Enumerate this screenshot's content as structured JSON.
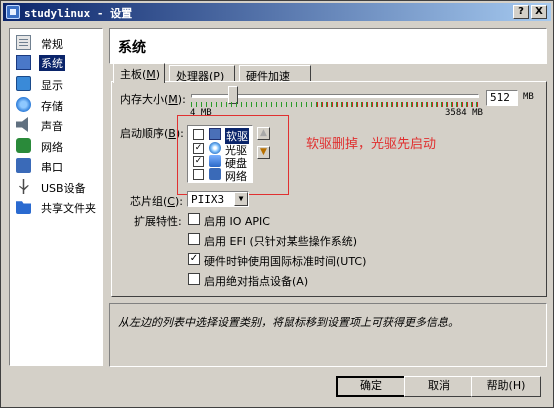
{
  "window": {
    "title": "studylinux - 设置",
    "help_glyph": "?",
    "close_glyph": "X"
  },
  "sidebar": {
    "items": [
      {
        "label": "常规",
        "icon": "general-icon"
      },
      {
        "label": "系统",
        "icon": "system-icon",
        "selected": true
      },
      {
        "label": "显示",
        "icon": "display-icon"
      },
      {
        "label": "存储",
        "icon": "storage-icon"
      },
      {
        "label": "声音",
        "icon": "audio-icon"
      },
      {
        "label": "网络",
        "icon": "network-icon"
      },
      {
        "label": "串口",
        "icon": "serial-port-icon"
      },
      {
        "label": "USB设备",
        "icon": "usb-icon"
      },
      {
        "label": "共享文件夹",
        "icon": "shared-folder-icon"
      }
    ]
  },
  "page": {
    "title": "系统"
  },
  "tabs": [
    {
      "label": "主板",
      "key": "M",
      "active": true
    },
    {
      "label": "处理器",
      "key": "P"
    },
    {
      "label": "硬件加速",
      "key": ""
    }
  ],
  "motherboard": {
    "memory": {
      "label": "内存大小",
      "key": "M",
      "value": "512",
      "unit": "MB",
      "min_label": "4 MB",
      "max_label": "3584 MB"
    },
    "boot_order": {
      "label": "启动顺序",
      "key": "B",
      "items": [
        {
          "label": "软驱",
          "checked": false,
          "icon": "floppy-icon",
          "selected": true
        },
        {
          "label": "光驱",
          "checked": true,
          "icon": "cd-icon"
        },
        {
          "label": "硬盘",
          "checked": true,
          "icon": "hdd-icon"
        },
        {
          "label": "网络",
          "checked": false,
          "icon": "network-boot-icon"
        }
      ],
      "up_glyph": "▲",
      "down_glyph": "▼"
    },
    "chipset": {
      "label": "芯片组",
      "key": "C",
      "value": "PIIX3"
    },
    "features": {
      "label": "扩展特性",
      "items": [
        {
          "label": "启用 IO APIC",
          "key": "I",
          "checked": false
        },
        {
          "label": "启用 EFI (只针对某些操作系统)",
          "key": "E",
          "checked": false
        },
        {
          "label": "硬件时钟使用国际标准时间(UTC)",
          "key": "U",
          "checked": true
        },
        {
          "label": "启用绝对指点设备(A)",
          "key": "A",
          "checked": false
        }
      ]
    }
  },
  "annotation": {
    "text": "软驱删掉，光驱先启动",
    "color": "#e03030"
  },
  "description": {
    "text": "从左边的列表中选择设置类别，将鼠标移到设置项上可获得更多信息。"
  },
  "buttons": {
    "ok": "确定",
    "cancel": "取消",
    "help": "帮助(H)"
  },
  "colors": {
    "selection": "#0a246a",
    "title_start": "#0a246a",
    "title_end": "#a6caf0"
  }
}
